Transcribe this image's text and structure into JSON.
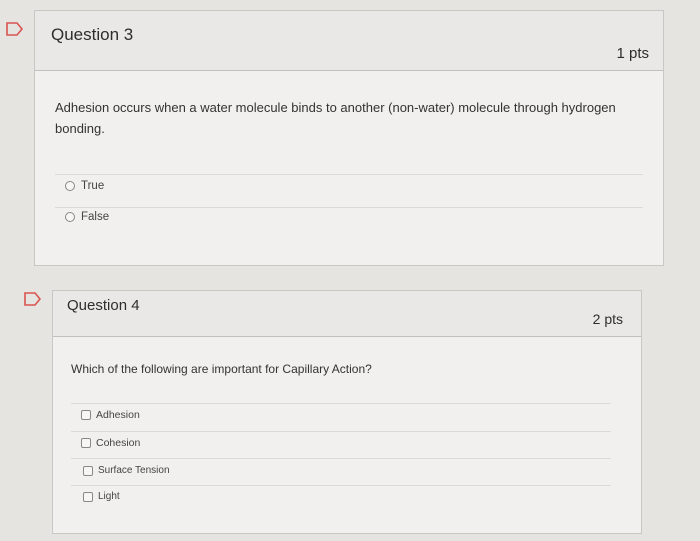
{
  "questions": [
    {
      "title": "Question 3",
      "points": "1 pts",
      "text": "Adhesion occurs when a water molecule binds to another (non-water) molecule through hydrogen bonding.",
      "type": "radio",
      "options": [
        "True",
        "False"
      ]
    },
    {
      "title": "Question 4",
      "points": "2 pts",
      "text": "Which of the following are important for Capillary Action?",
      "type": "checkbox",
      "options": [
        "Adhesion",
        "Cohesion",
        "Surface Tension",
        "Light"
      ]
    }
  ],
  "colors": {
    "flag": "#d9534f",
    "card": "#f1f0ee",
    "header": "#e9e8e6"
  },
  "icons": {
    "flag": "flag-outline-icon"
  }
}
